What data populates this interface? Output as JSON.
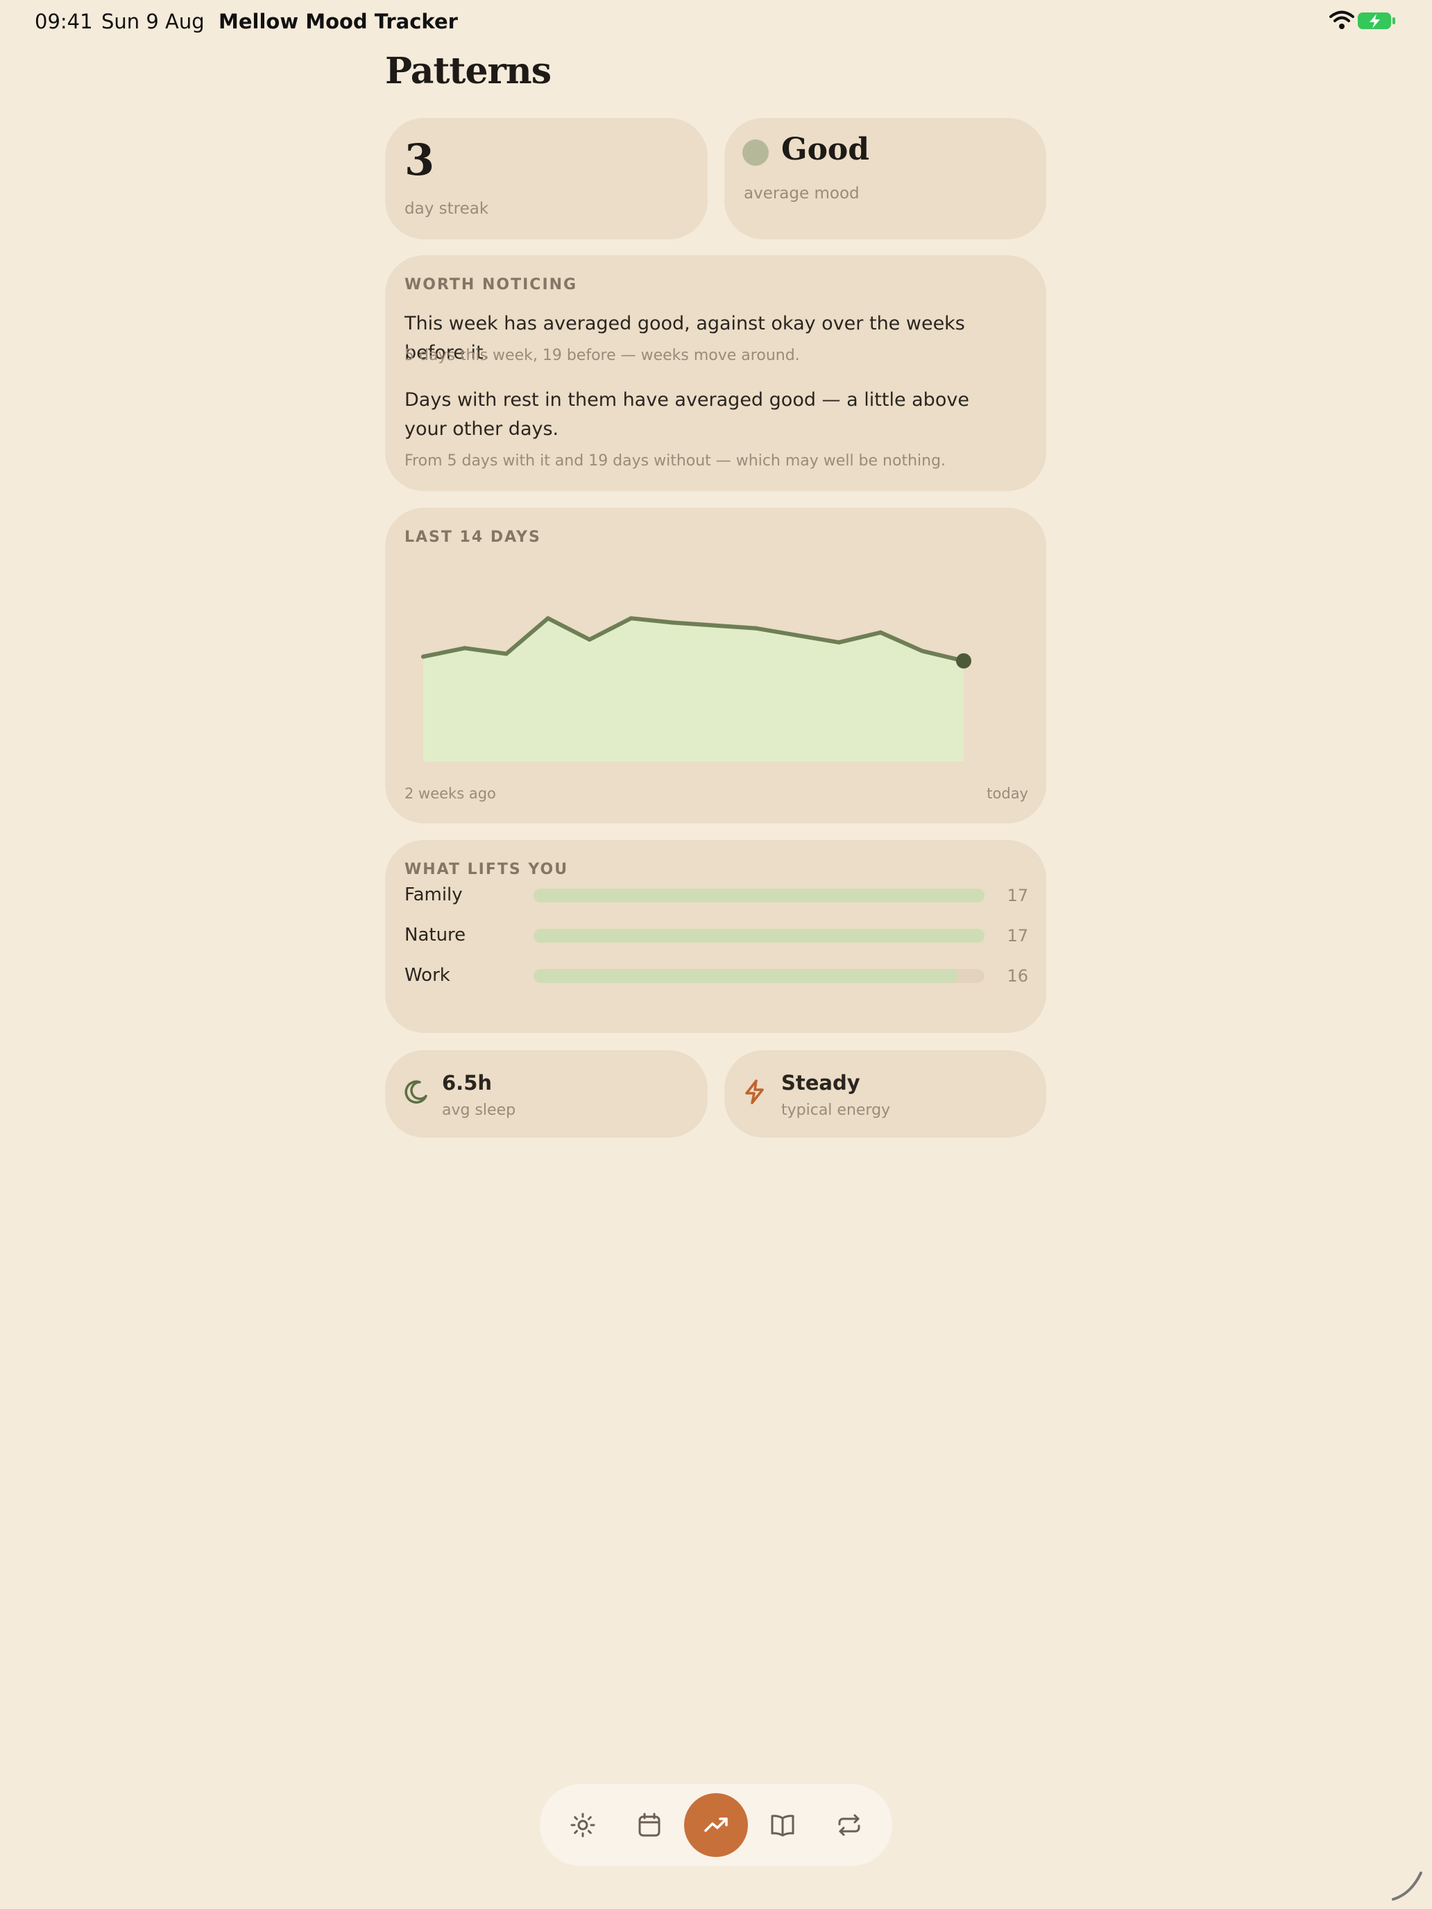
{
  "status_bar": {
    "time": "09:41",
    "date": "Sun 9 Aug",
    "app_name": "Mellow Mood Tracker",
    "wifi_icon": "wifi-icon",
    "battery_icon": "battery-charging-icon"
  },
  "page": {
    "title": "Patterns"
  },
  "streak": {
    "value": "3",
    "label": "day streak"
  },
  "average_mood": {
    "value": "Good",
    "label": "average mood",
    "dot_color": "#B5B99A"
  },
  "worth_noticing": {
    "heading": "WORTH NOTICING",
    "items": [
      {
        "text": "This week has averaged good, against okay over the weeks before it.",
        "detail": "5 days this week, 19 before — weeks move around."
      },
      {
        "text": "Days with rest in them have averaged good — a little above your other days.",
        "detail": "From 5 days with it and 19 days without — which may well be nothing."
      }
    ]
  },
  "trend": {
    "heading": "LAST 14 DAYS",
    "start_label": "2 weeks ago",
    "end_label": "today"
  },
  "chart_data": {
    "type": "area",
    "title": "LAST 14 DAYS",
    "x": [
      1,
      2,
      3,
      4,
      5,
      6,
      7,
      8,
      9,
      10,
      11,
      12,
      13,
      14
    ],
    "values": [
      0.49,
      0.55,
      0.51,
      0.76,
      0.61,
      0.76,
      0.73,
      0.71,
      0.69,
      0.64,
      0.59,
      0.66,
      0.53,
      0.46
    ],
    "ylim": [
      -0.25,
      1.05
    ],
    "line_color": "#6E7E55",
    "fill_color": "#E1EDC9",
    "xlabel_start": "2 weeks ago",
    "xlabel_end": "today"
  },
  "lifts": {
    "heading": "WHAT LIFTS YOU",
    "max": 17,
    "items": [
      {
        "name": "Family",
        "count": 17
      },
      {
        "name": "Nature",
        "count": 17
      },
      {
        "name": "Work",
        "count": 16
      }
    ]
  },
  "sleep": {
    "value": "6.5h",
    "label": "avg sleep",
    "icon": "moon-icon"
  },
  "energy": {
    "value": "Steady",
    "label": "typical energy",
    "icon": "lightning-icon"
  },
  "nav": {
    "items": [
      {
        "id": "today",
        "icon": "sun-icon"
      },
      {
        "id": "calendar",
        "icon": "calendar-icon"
      },
      {
        "id": "patterns",
        "icon": "trending-up-icon",
        "active": true
      },
      {
        "id": "journal",
        "icon": "book-icon"
      },
      {
        "id": "routines",
        "icon": "repeat-icon"
      }
    ]
  },
  "colors": {
    "background": "#F5EBDB",
    "card": "#EBDDC7",
    "accent": "#C8703A",
    "line": "#6E7E55"
  }
}
